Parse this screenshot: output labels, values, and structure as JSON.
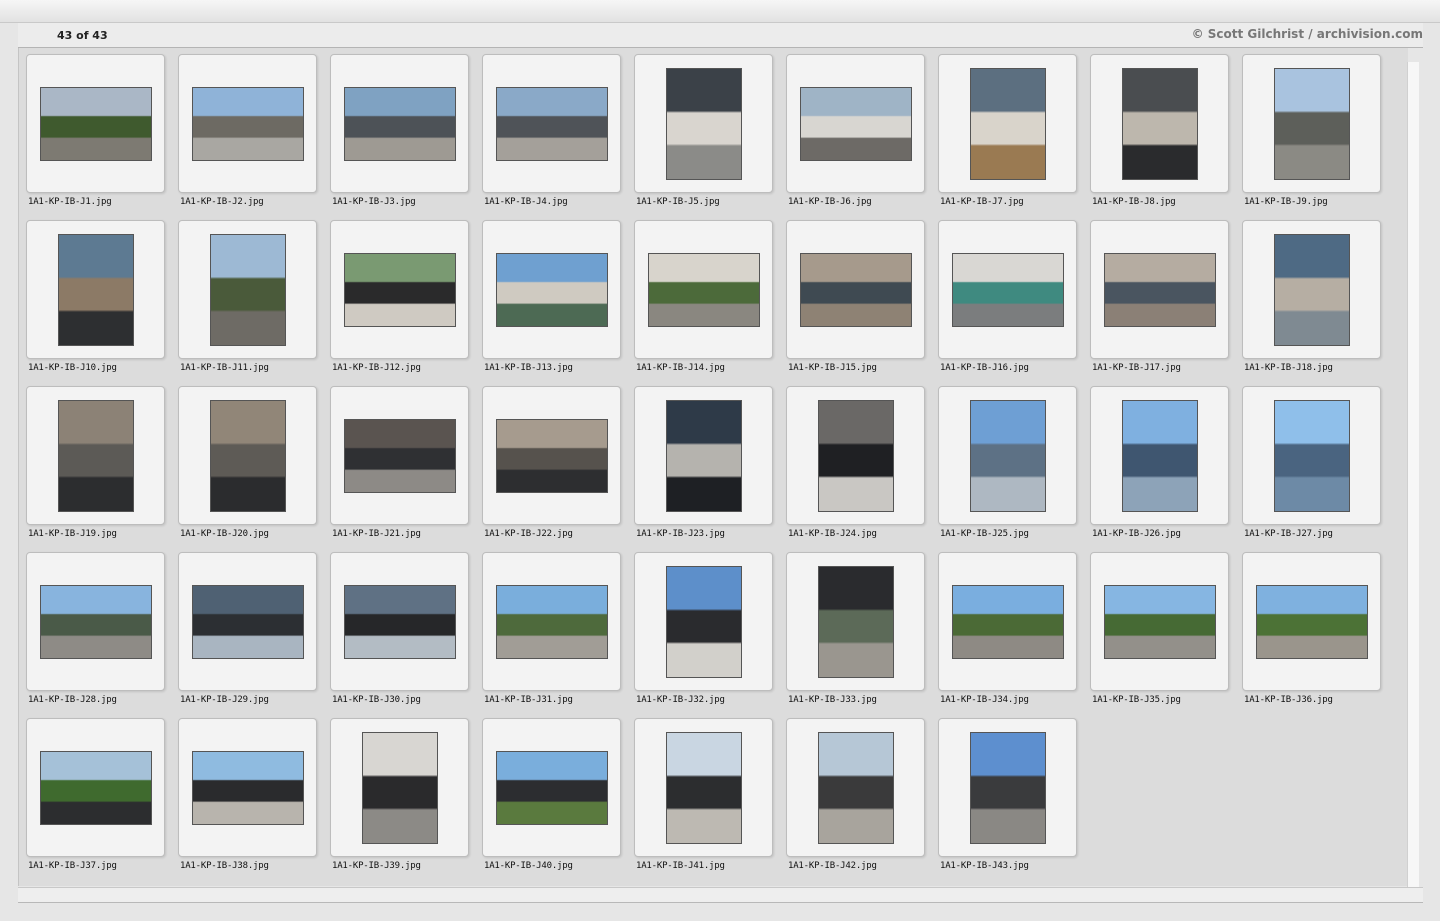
{
  "header": {
    "counter": "43 of 43",
    "copyright": "© Scott Gilchrist / archivision.com"
  },
  "thumbnails": [
    {
      "filename": "1A1-KP-IB-J1.jpg",
      "orientation": "landscape",
      "colors": [
        "#aab7c6",
        "#3f5a2e",
        "#7d7a72"
      ]
    },
    {
      "filename": "1A1-KP-IB-J2.jpg",
      "orientation": "landscape",
      "colors": [
        "#8fb3d8",
        "#6d6a63",
        "#a9a7a2"
      ]
    },
    {
      "filename": "1A1-KP-IB-J3.jpg",
      "orientation": "landscape",
      "colors": [
        "#7fa2c2",
        "#4d5257",
        "#9e9a93"
      ]
    },
    {
      "filename": "1A1-KP-IB-J4.jpg",
      "orientation": "landscape",
      "colors": [
        "#8aa9c8",
        "#4f5358",
        "#a4a09a"
      ]
    },
    {
      "filename": "1A1-KP-IB-J5.jpg",
      "orientation": "portrait",
      "colors": [
        "#3b4148",
        "#d9d5cf",
        "#8b8b88"
      ]
    },
    {
      "filename": "1A1-KP-IB-J6.jpg",
      "orientation": "landscape",
      "colors": [
        "#9fb4c6",
        "#d8d6d1",
        "#6d6a66"
      ]
    },
    {
      "filename": "1A1-KP-IB-J7.jpg",
      "orientation": "portrait",
      "colors": [
        "#5c6f80",
        "#d9d4cb",
        "#9a7a52"
      ]
    },
    {
      "filename": "1A1-KP-IB-J8.jpg",
      "orientation": "portrait",
      "colors": [
        "#4a4d50",
        "#bdb7ad",
        "#2a2b2d"
      ]
    },
    {
      "filename": "1A1-KP-IB-J9.jpg",
      "orientation": "portrait",
      "colors": [
        "#a9c3df",
        "#5d5f5a",
        "#8b8a84"
      ]
    },
    {
      "filename": "1A1-KP-IB-J10.jpg",
      "orientation": "portrait",
      "colors": [
        "#5d7a92",
        "#8c7a66",
        "#2d2f31"
      ]
    },
    {
      "filename": "1A1-KP-IB-J11.jpg",
      "orientation": "portrait",
      "colors": [
        "#9db9d4",
        "#4a5a3a",
        "#6e6b65"
      ]
    },
    {
      "filename": "1A1-KP-IB-J12.jpg",
      "orientation": "landscape",
      "colors": [
        "#7a9a72",
        "#2a2a2b",
        "#cfcac2"
      ]
    },
    {
      "filename": "1A1-KP-IB-J13.jpg",
      "orientation": "landscape",
      "colors": [
        "#6fa0d0",
        "#cfcac1",
        "#4d6a54"
      ]
    },
    {
      "filename": "1A1-KP-IB-J14.jpg",
      "orientation": "landscape",
      "colors": [
        "#d8d4cc",
        "#4c6a3a",
        "#8a8780"
      ]
    },
    {
      "filename": "1A1-KP-IB-J15.jpg",
      "orientation": "landscape",
      "colors": [
        "#a69a8c",
        "#3f4a52",
        "#8e8274"
      ]
    },
    {
      "filename": "1A1-KP-IB-J16.jpg",
      "orientation": "landscape",
      "colors": [
        "#d9d7d3",
        "#3f8a80",
        "#7b7d7e"
      ]
    },
    {
      "filename": "1A1-KP-IB-J17.jpg",
      "orientation": "landscape",
      "colors": [
        "#b5aca1",
        "#4a5560",
        "#8b8076"
      ]
    },
    {
      "filename": "1A1-KP-IB-J18.jpg",
      "orientation": "portrait",
      "colors": [
        "#4e6a84",
        "#b6aea3",
        "#7f8a92"
      ]
    },
    {
      "filename": "1A1-KP-IB-J19.jpg",
      "orientation": "portrait",
      "colors": [
        "#8c8276",
        "#5c5a56",
        "#2c2d2f"
      ]
    },
    {
      "filename": "1A1-KP-IB-J20.jpg",
      "orientation": "portrait",
      "colors": [
        "#918678",
        "#5e5b56",
        "#2b2c2e"
      ]
    },
    {
      "filename": "1A1-KP-IB-J21.jpg",
      "orientation": "landscape",
      "colors": [
        "#5a5450",
        "#2f3033",
        "#8d8a86"
      ]
    },
    {
      "filename": "1A1-KP-IB-J22.jpg",
      "orientation": "landscape",
      "colors": [
        "#a69b8e",
        "#56524d",
        "#2d2e30"
      ]
    },
    {
      "filename": "1A1-KP-IB-J23.jpg",
      "orientation": "portrait",
      "colors": [
        "#2e3a48",
        "#b5b3ae",
        "#1e2024"
      ]
    },
    {
      "filename": "1A1-KP-IB-J24.jpg",
      "orientation": "portrait",
      "colors": [
        "#6a6866",
        "#1f2023",
        "#c9c7c3"
      ]
    },
    {
      "filename": "1A1-KP-IB-J25.jpg",
      "orientation": "portrait",
      "colors": [
        "#6e9fd4",
        "#5d7185",
        "#aeb8c2"
      ]
    },
    {
      "filename": "1A1-KP-IB-J26.jpg",
      "orientation": "portrait",
      "colors": [
        "#7fb0e0",
        "#3f5670",
        "#8da3b8"
      ]
    },
    {
      "filename": "1A1-KP-IB-J27.jpg",
      "orientation": "portrait",
      "colors": [
        "#8fbfea",
        "#4a6480",
        "#6d8aa6"
      ]
    },
    {
      "filename": "1A1-KP-IB-J28.jpg",
      "orientation": "landscape",
      "colors": [
        "#88b4de",
        "#4a5a48",
        "#8e8b86"
      ]
    },
    {
      "filename": "1A1-KP-IB-J29.jpg",
      "orientation": "landscape",
      "colors": [
        "#4f6173",
        "#2c2f33",
        "#a9b5c1"
      ]
    },
    {
      "filename": "1A1-KP-IB-J30.jpg",
      "orientation": "landscape",
      "colors": [
        "#5f7184",
        "#262729",
        "#b3bcc4"
      ]
    },
    {
      "filename": "1A1-KP-IB-J31.jpg",
      "orientation": "landscape",
      "colors": [
        "#7aaedc",
        "#4e6a3c",
        "#a19d96"
      ]
    },
    {
      "filename": "1A1-KP-IB-J32.jpg",
      "orientation": "portrait",
      "colors": [
        "#5d8fca",
        "#2a2b2e",
        "#d2d0cb"
      ]
    },
    {
      "filename": "1A1-KP-IB-J33.jpg",
      "orientation": "portrait",
      "colors": [
        "#2a2b2e",
        "#5c6a58",
        "#9a968f"
      ]
    },
    {
      "filename": "1A1-KP-IB-J34.jpg",
      "orientation": "landscape",
      "colors": [
        "#7aaedf",
        "#4b6a36",
        "#8e8a84"
      ]
    },
    {
      "filename": "1A1-KP-IB-J35.jpg",
      "orientation": "landscape",
      "colors": [
        "#86b6e2",
        "#466a34",
        "#93908a"
      ]
    },
    {
      "filename": "1A1-KP-IB-J36.jpg",
      "orientation": "landscape",
      "colors": [
        "#7fb1df",
        "#4c7236",
        "#9a958c"
      ]
    },
    {
      "filename": "1A1-KP-IB-J37.jpg",
      "orientation": "landscape",
      "colors": [
        "#a5c1d8",
        "#3f6a2e",
        "#2c2d2f"
      ]
    },
    {
      "filename": "1A1-KP-IB-J38.jpg",
      "orientation": "landscape",
      "colors": [
        "#8fbbe0",
        "#2a2b2d",
        "#b8b4ad"
      ]
    },
    {
      "filename": "1A1-KP-IB-J39.jpg",
      "orientation": "portrait",
      "colors": [
        "#d8d6d2",
        "#2a2a2c",
        "#8c8a86"
      ]
    },
    {
      "filename": "1A1-KP-IB-J40.jpg",
      "orientation": "landscape",
      "colors": [
        "#7aaedc",
        "#2c2d30",
        "#5a7a3e"
      ]
    },
    {
      "filename": "1A1-KP-IB-J41.jpg",
      "orientation": "portrait",
      "colors": [
        "#c9d6e2",
        "#2c2d2f",
        "#bdb9b2"
      ]
    },
    {
      "filename": "1A1-KP-IB-J42.jpg",
      "orientation": "portrait",
      "colors": [
        "#b6c7d6",
        "#3a3a3b",
        "#a8a49d"
      ]
    },
    {
      "filename": "1A1-KP-IB-J43.jpg",
      "orientation": "portrait",
      "colors": [
        "#5d8fcf",
        "#3a3b3d",
        "#8a8884"
      ]
    }
  ]
}
